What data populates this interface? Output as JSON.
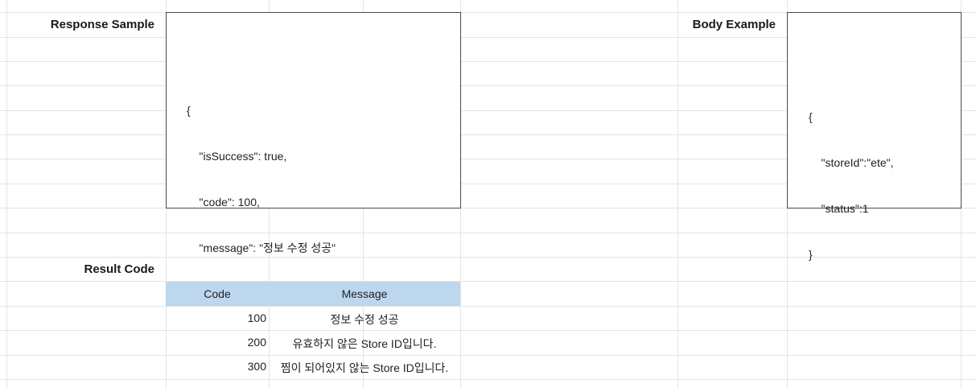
{
  "labels": {
    "response_sample": "Response Sample",
    "body_example": "Body Example",
    "result_code": "Result Code"
  },
  "response_sample": {
    "lines": [
      "{",
      "    \"isSuccess\": true,",
      "    \"code\": 100,",
      "    \"message\": \"정보 수정 성공\"",
      "}"
    ]
  },
  "body_example": {
    "lines": [
      "{",
      "    \"storeId\":\"ete\",",
      "    \"status\":1",
      "}"
    ]
  },
  "result_table": {
    "headers": [
      "Code",
      "Message"
    ],
    "rows": [
      {
        "code": "100",
        "message": "정보 수정 성공"
      },
      {
        "code": "200",
        "message": "유효하지 않은 Store ID입니다."
      },
      {
        "code": "300",
        "message": "찜이 되어있지 않는 Store ID입니다."
      }
    ],
    "header_color": "#bdd7ee"
  }
}
